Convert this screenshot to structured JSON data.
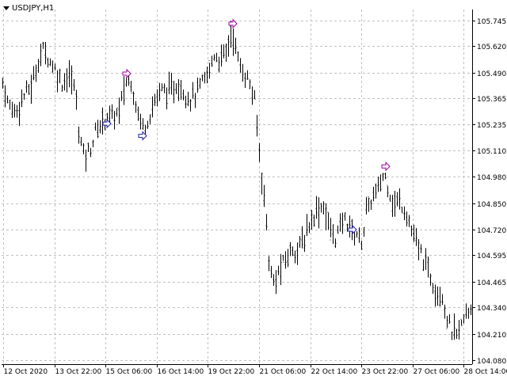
{
  "window": {
    "title": "USDJPY,H1"
  },
  "colors": {
    "background": "#ffffff",
    "grid": "#c0c0c0",
    "bars": "#000000",
    "axis_text": "#000000",
    "buy_arrow": "#1e1ea0",
    "sell_arrow": "#a000a0"
  },
  "chart_data": {
    "type": "ohlc",
    "symbol": "USDJPY",
    "timeframe": "H1",
    "y_ticks": [
      "105.745",
      "105.620",
      "105.490",
      "105.365",
      "105.235",
      "105.110",
      "104.980",
      "104.850",
      "104.720",
      "104.595",
      "104.465",
      "104.340",
      "104.210",
      "104.080"
    ],
    "ylim": [
      104.08,
      105.745
    ],
    "x_ticks": [
      "12 Oct 2020",
      "13 Oct 22:00",
      "15 Oct 06:00",
      "16 Oct 14:00",
      "19 Oct 22:00",
      "21 Oct 06:00",
      "22 Oct 14:00",
      "23 Oct 22:00",
      "27 Oct 06:00",
      "28 Oct 14:00"
    ],
    "grid": true,
    "path_points": [
      [
        0,
        105.49
      ],
      [
        10,
        105.33
      ],
      [
        20,
        105.3
      ],
      [
        30,
        105.38
      ],
      [
        40,
        105.43
      ],
      [
        48,
        105.55
      ],
      [
        55,
        105.61
      ],
      [
        62,
        105.55
      ],
      [
        70,
        105.5
      ],
      [
        78,
        105.44
      ],
      [
        86,
        105.48
      ],
      [
        94,
        105.42
      ],
      [
        100,
        105.18
      ],
      [
        106,
        105.08
      ],
      [
        114,
        105.12
      ],
      [
        120,
        105.2
      ],
      [
        128,
        105.24
      ],
      [
        134,
        105.28
      ],
      [
        142,
        105.27
      ],
      [
        150,
        105.3
      ],
      [
        158,
        105.44
      ],
      [
        164,
        105.46
      ],
      [
        170,
        105.36
      ],
      [
        176,
        105.26
      ],
      [
        182,
        105.22
      ],
      [
        190,
        105.3
      ],
      [
        198,
        105.38
      ],
      [
        206,
        105.41
      ],
      [
        214,
        105.39
      ],
      [
        222,
        105.43
      ],
      [
        230,
        105.41
      ],
      [
        238,
        105.36
      ],
      [
        246,
        105.38
      ],
      [
        254,
        105.43
      ],
      [
        262,
        105.48
      ],
      [
        270,
        105.58
      ],
      [
        278,
        105.55
      ],
      [
        286,
        105.6
      ],
      [
        292,
        105.7
      ],
      [
        298,
        105.59
      ],
      [
        304,
        105.5
      ],
      [
        310,
        105.48
      ],
      [
        316,
        105.42
      ],
      [
        322,
        105.33
      ],
      [
        328,
        105.05
      ],
      [
        334,
        104.86
      ],
      [
        340,
        104.52
      ],
      [
        346,
        104.45
      ],
      [
        352,
        104.52
      ],
      [
        360,
        104.57
      ],
      [
        368,
        104.63
      ],
      [
        376,
        104.62
      ],
      [
        384,
        104.68
      ],
      [
        392,
        104.77
      ],
      [
        400,
        104.82
      ],
      [
        408,
        104.84
      ],
      [
        416,
        104.72
      ],
      [
        424,
        104.68
      ],
      [
        430,
        104.74
      ],
      [
        436,
        104.78
      ],
      [
        442,
        104.72
      ],
      [
        450,
        104.7
      ],
      [
        456,
        104.66
      ],
      [
        462,
        104.8
      ],
      [
        470,
        104.88
      ],
      [
        478,
        104.92
      ],
      [
        484,
        105.0
      ],
      [
        490,
        104.93
      ],
      [
        496,
        104.84
      ],
      [
        504,
        104.86
      ],
      [
        512,
        104.81
      ],
      [
        518,
        104.73
      ],
      [
        524,
        104.66
      ],
      [
        530,
        104.61
      ],
      [
        536,
        104.56
      ],
      [
        544,
        104.48
      ],
      [
        550,
        104.43
      ],
      [
        558,
        104.4
      ],
      [
        564,
        104.28
      ],
      [
        570,
        104.22
      ],
      [
        576,
        104.2
      ],
      [
        582,
        104.25
      ],
      [
        588,
        104.3
      ],
      [
        594,
        104.34
      ]
    ],
    "signals": [
      {
        "type": "buy",
        "time": "15 Oct",
        "price": 105.24
      },
      {
        "type": "sell",
        "time": "15 Oct",
        "price": 105.485
      },
      {
        "type": "buy",
        "time": "16 Oct",
        "price": 105.18
      },
      {
        "type": "sell",
        "time": "20 Oct",
        "price": 105.73
      },
      {
        "type": "buy",
        "time": "23 Oct",
        "price": 104.72
      },
      {
        "type": "sell",
        "time": "26 Oct",
        "price": 105.03
      }
    ]
  }
}
